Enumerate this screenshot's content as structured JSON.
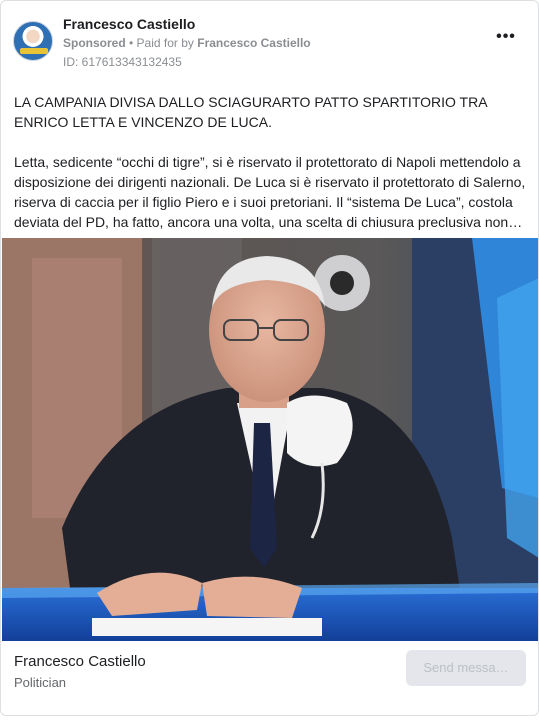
{
  "post": {
    "author": "Francesco Castiello",
    "sponsored": "Sponsored",
    "separator": " • ",
    "paid_for_prefix": "Paid for by ",
    "payer": "Francesco Castiello",
    "ad_id": "ID: 617613343132435",
    "more_icon": "more-options-icon",
    "paragraphs": [
      "LA CAMPANIA DIVISA DALLO SCIAGURARTO PATTO SPARTITORIO TRA ENRICO LETTA E VINCENZO DE LUCA.",
      "Letta, sedicente “occhi di tigre”, si è riservato il protettorato di Napoli mettendolo a disposizione dei dirigenti nazionali. De Luca si è riservato il protettorato di Salerno, riserva di caccia per il figlio Piero e i suoi pretoriani. Il “sistema De Luca”, costola deviata del PD, ha fatto, ancora una volta, una scelta di chiusura preclusiva non…"
    ]
  },
  "footer": {
    "page_name": "Francesco Castiello",
    "category": "Politician",
    "send_button": "Send messa…"
  }
}
